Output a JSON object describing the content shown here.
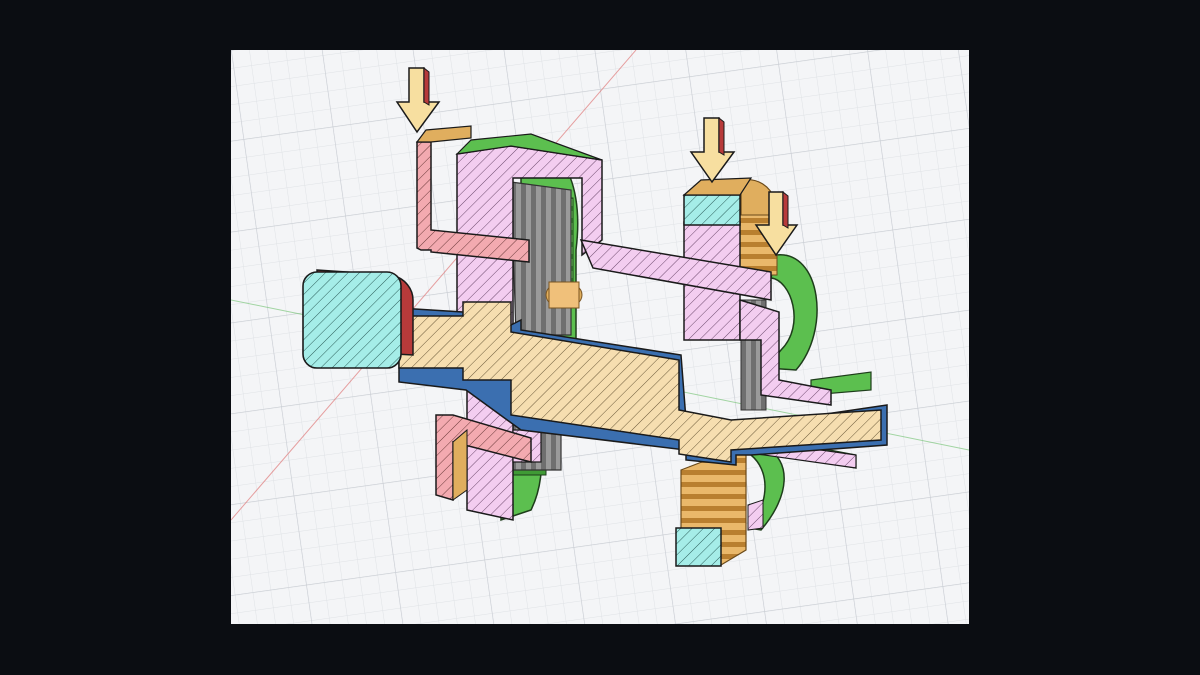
{
  "viewport": {
    "background": "#f4f5f7",
    "frame_color": "#0b0d12",
    "grid": true,
    "grid_minor_color": "#dfe2e6",
    "grid_major_color": "#c9cdd3",
    "axis_x_color": "#e07a7a",
    "axis_y_color": "#7ec77e"
  },
  "model": {
    "view": "section-cut",
    "parts": [
      {
        "name": "output-shaft",
        "color": "#f6deb0",
        "edge_color": "#3b6fb0"
      },
      {
        "name": "ring-gear-housing",
        "color": "#f3cdf0"
      },
      {
        "name": "outer-ring",
        "color": "#5cbf4f"
      },
      {
        "name": "bracket",
        "color": "#f3aab0"
      },
      {
        "name": "end-cap",
        "color": "#a5ede8",
        "edge_color": "#b73a3a"
      },
      {
        "name": "planet-gears",
        "color": "#8a8a8a"
      },
      {
        "name": "sun-gear-stack",
        "color": "#e0ae5e"
      }
    ],
    "load_arrows": 3,
    "arrow_color": "#f7dfa0"
  }
}
